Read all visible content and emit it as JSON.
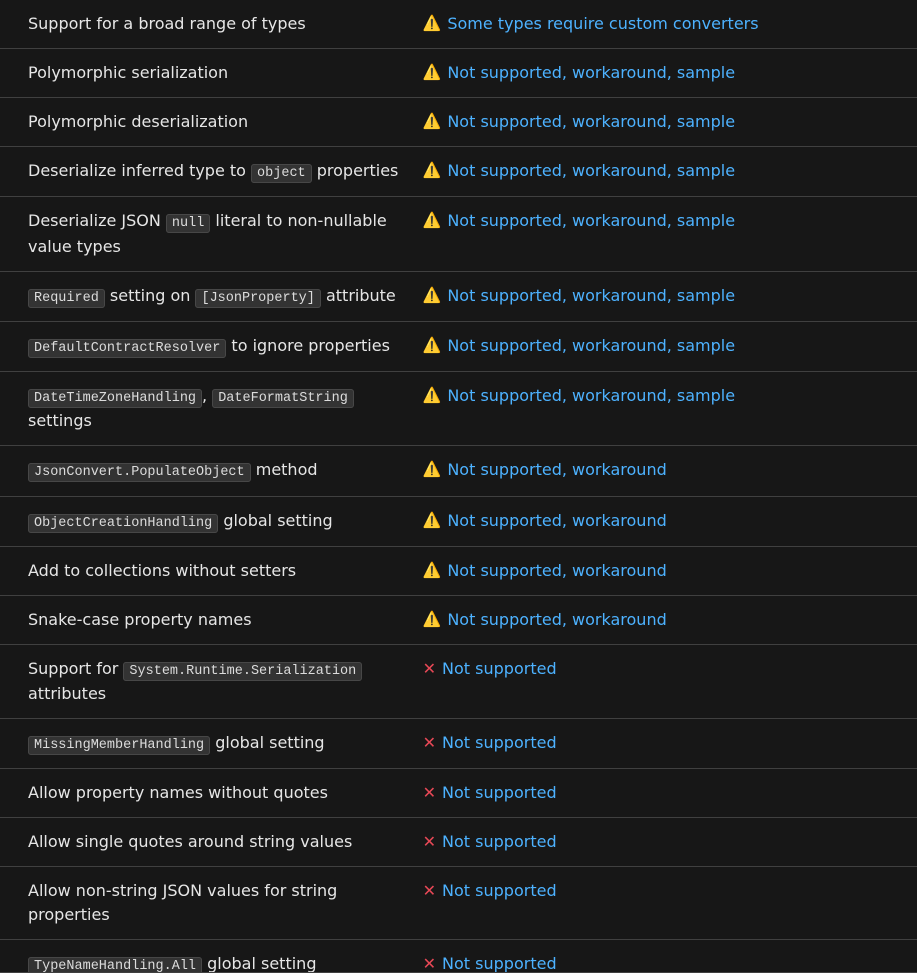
{
  "rows": [
    {
      "feature": [
        {
          "type": "text",
          "value": "Support for a broad range of types"
        }
      ],
      "status": {
        "icon": "warn",
        "link": "Some types require custom converters"
      }
    },
    {
      "feature": [
        {
          "type": "text",
          "value": "Polymorphic serialization"
        }
      ],
      "status": {
        "icon": "warn",
        "link": "Not supported, workaround, sample"
      }
    },
    {
      "feature": [
        {
          "type": "text",
          "value": "Polymorphic deserialization"
        }
      ],
      "status": {
        "icon": "warn",
        "link": "Not supported, workaround, sample"
      }
    },
    {
      "feature": [
        {
          "type": "text",
          "value": "Deserialize inferred type to "
        },
        {
          "type": "code",
          "value": "object"
        },
        {
          "type": "text",
          "value": " properties"
        }
      ],
      "status": {
        "icon": "warn",
        "link": "Not supported, workaround, sample"
      }
    },
    {
      "feature": [
        {
          "type": "text",
          "value": "Deserialize JSON "
        },
        {
          "type": "code",
          "value": "null"
        },
        {
          "type": "text",
          "value": " literal to non-nullable value types"
        }
      ],
      "status": {
        "icon": "warn",
        "link": "Not supported, workaround, sample"
      }
    },
    {
      "feature": [
        {
          "type": "code",
          "value": "Required"
        },
        {
          "type": "text",
          "value": " setting on "
        },
        {
          "type": "code",
          "value": "[JsonProperty]"
        },
        {
          "type": "text",
          "value": " attribute"
        }
      ],
      "status": {
        "icon": "warn",
        "link": "Not supported, workaround, sample"
      }
    },
    {
      "feature": [
        {
          "type": "code",
          "value": "DefaultContractResolver"
        },
        {
          "type": "text",
          "value": " to ignore properties"
        }
      ],
      "status": {
        "icon": "warn",
        "link": "Not supported, workaround, sample"
      }
    },
    {
      "feature": [
        {
          "type": "code",
          "value": "DateTimeZoneHandling"
        },
        {
          "type": "text",
          "value": ", "
        },
        {
          "type": "code",
          "value": "DateFormatString"
        },
        {
          "type": "text",
          "value": " settings"
        }
      ],
      "status": {
        "icon": "warn",
        "link": "Not supported, workaround, sample"
      }
    },
    {
      "feature": [
        {
          "type": "code",
          "value": "JsonConvert.PopulateObject"
        },
        {
          "type": "text",
          "value": " method"
        }
      ],
      "status": {
        "icon": "warn",
        "link": "Not supported, workaround"
      }
    },
    {
      "feature": [
        {
          "type": "code",
          "value": "ObjectCreationHandling"
        },
        {
          "type": "text",
          "value": " global setting"
        }
      ],
      "status": {
        "icon": "warn",
        "link": "Not supported, workaround"
      }
    },
    {
      "feature": [
        {
          "type": "text",
          "value": "Add to collections without setters"
        }
      ],
      "status": {
        "icon": "warn",
        "link": "Not supported, workaround"
      }
    },
    {
      "feature": [
        {
          "type": "text",
          "value": "Snake-case property names"
        }
      ],
      "status": {
        "icon": "warn",
        "link": "Not supported, workaround"
      }
    },
    {
      "feature": [
        {
          "type": "text",
          "value": "Support for "
        },
        {
          "type": "code",
          "value": "System.Runtime.Serialization"
        },
        {
          "type": "text",
          "value": " attributes"
        }
      ],
      "status": {
        "icon": "cross",
        "link": "Not supported"
      }
    },
    {
      "feature": [
        {
          "type": "code",
          "value": "MissingMemberHandling"
        },
        {
          "type": "text",
          "value": " global setting"
        }
      ],
      "status": {
        "icon": "cross",
        "link": "Not supported"
      }
    },
    {
      "feature": [
        {
          "type": "text",
          "value": "Allow property names without quotes"
        }
      ],
      "status": {
        "icon": "cross",
        "link": "Not supported"
      }
    },
    {
      "feature": [
        {
          "type": "text",
          "value": "Allow single quotes around string values"
        }
      ],
      "status": {
        "icon": "cross",
        "link": "Not supported"
      }
    },
    {
      "feature": [
        {
          "type": "text",
          "value": "Allow non-string JSON values for string properties"
        }
      ],
      "status": {
        "icon": "cross",
        "link": "Not supported"
      }
    },
    {
      "feature": [
        {
          "type": "code",
          "value": "TypeNameHandling.All"
        },
        {
          "type": "text",
          "value": " global setting"
        }
      ],
      "status": {
        "icon": "cross",
        "link": "Not supported"
      },
      "partial": true
    }
  ]
}
